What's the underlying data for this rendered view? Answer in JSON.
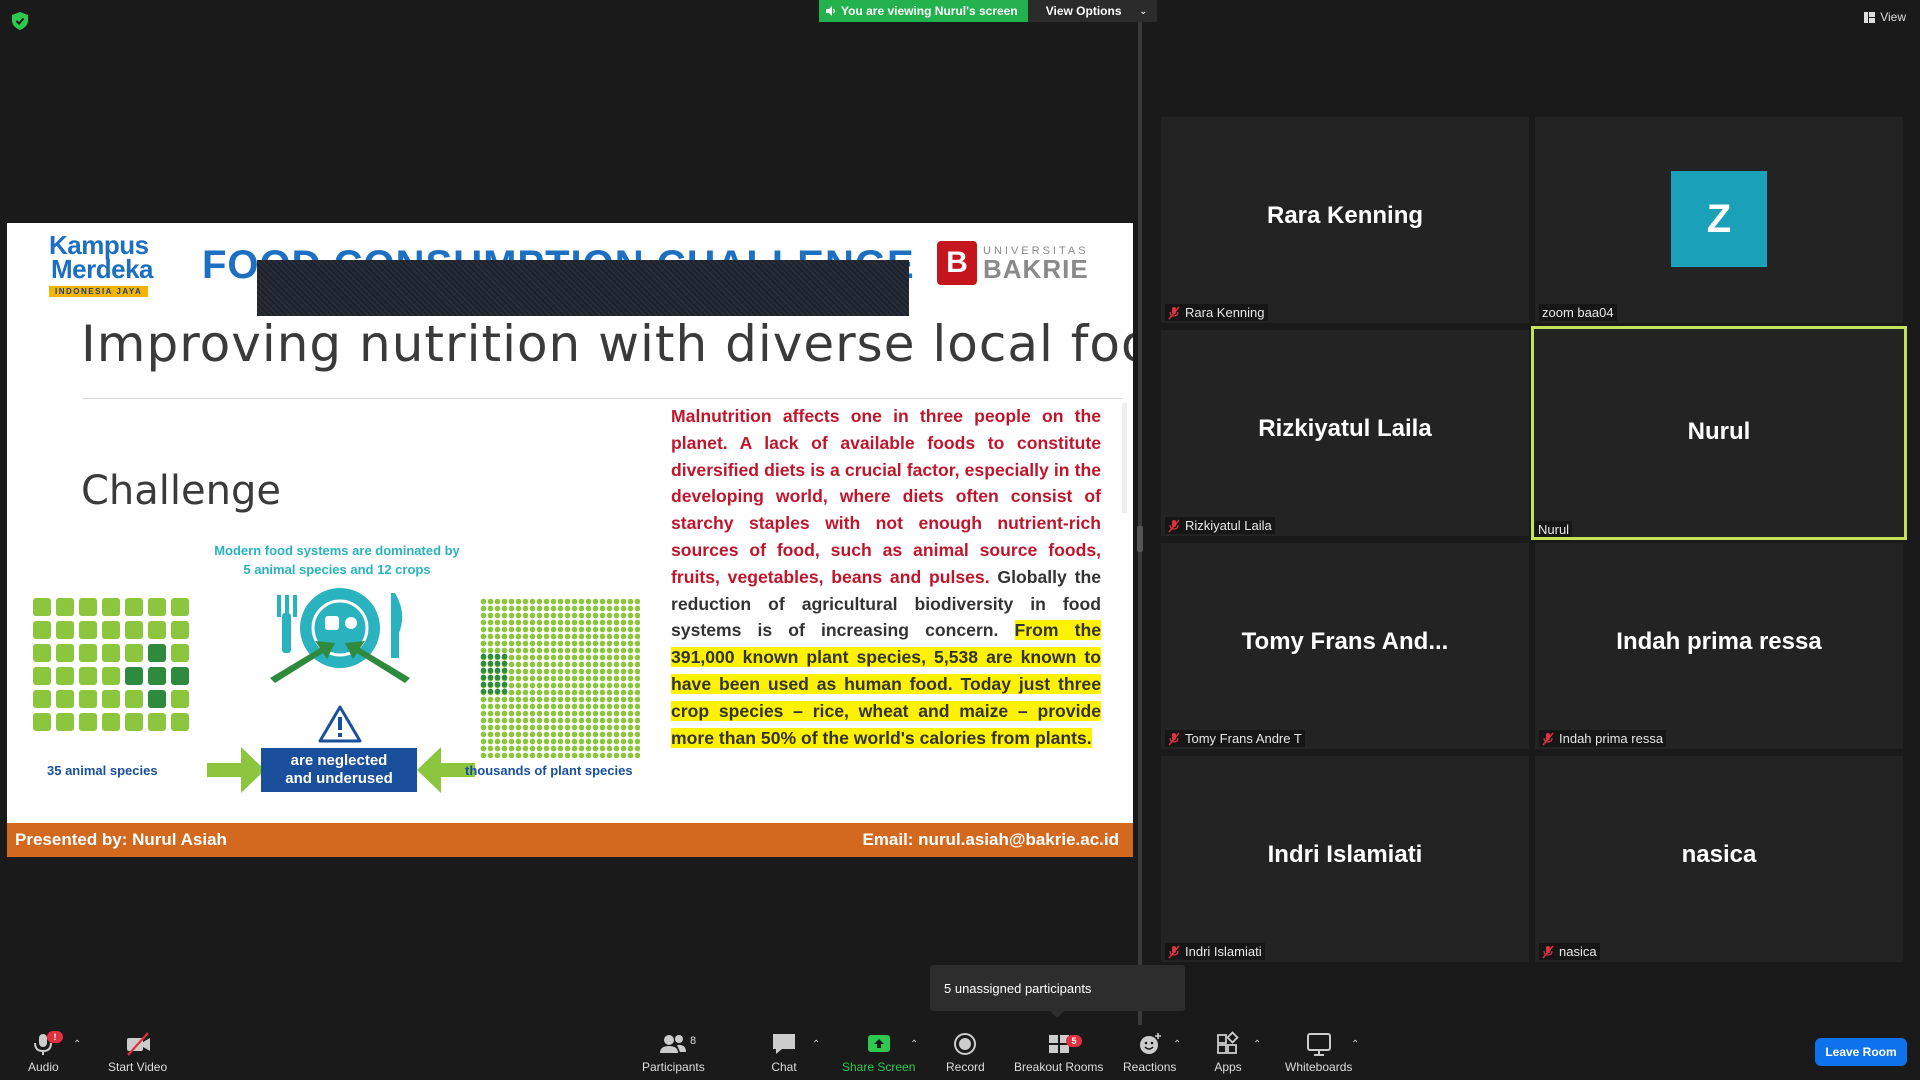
{
  "share_banner": {
    "viewing_text": "You are viewing Nurul's screen",
    "view_options_label": "View Options"
  },
  "view_button": {
    "label": "View"
  },
  "slide": {
    "logo_left": {
      "line1": "Kampus",
      "line2": "Merdeka",
      "tagline": "INDONESIA JAYA"
    },
    "header": "FOOD CONSUMPTION CHALLENGE",
    "logo_right": {
      "mark": "B",
      "line1": "UNIVERSITAS",
      "line2": "BAKRIE"
    },
    "title": "Improving nutrition with diverse local foods",
    "section": "Challenge",
    "infographic": {
      "caption_line1": "Modern food systems are dominated by",
      "caption_line2": "5 animal species and 12 crops",
      "neglected_line1": "are neglected",
      "neglected_line2": "and underused",
      "animal_label": "35 animal species",
      "plant_label": "thousands of plant species"
    },
    "body": {
      "red": "Malnutrition affects one in three people on the planet. A lack of available foods to constitute diversified diets is a crucial factor, especially in the developing world, where diets often consist of starchy staples with not enough nutrient-rich sources of food, such as animal source foods, fruits, vegetables, beans and pulses.",
      "plain": " Globally the reduction of agricultural biodiversity in food systems is of increasing concern. ",
      "highlight": "From the 391,000 known plant species, 5,538 are known to have been used as human food. Today just three crop species – rice, wheat and maize – provide more than 50% of the world's calories from plants."
    },
    "footer": {
      "presenter": "Presented by: Nurul Asiah",
      "email": "Email: nurul.asiah@bakrie.ac.id"
    }
  },
  "gallery": [
    {
      "name": "Rara Kenning",
      "label": "Rara Kenning",
      "muted": true
    },
    {
      "name": "",
      "avatar": "Z",
      "label": "zoom baa04",
      "muted": false
    },
    {
      "name": "Rizkiyatul Laila",
      "label": "Rizkiyatul Laila",
      "muted": true
    },
    {
      "name": "Nurul",
      "label": "Nurul",
      "muted": false,
      "active": true
    },
    {
      "name": "Tomy  Frans  And...",
      "label": "Tomy Frans Andre T",
      "muted": true
    },
    {
      "name": "Indah prima ressa",
      "label": "Indah prima ressa",
      "muted": true
    },
    {
      "name": "Indri Islamiati",
      "label": "Indri Islamiati",
      "muted": true
    },
    {
      "name": "nasica",
      "label": "nasica",
      "muted": true
    }
  ],
  "tooltip": {
    "text": "5 unassigned participants"
  },
  "toolbar": {
    "audio": "Audio",
    "audio_badge": "!",
    "start_video": "Start Video",
    "participants": "Participants",
    "participants_count": "8",
    "chat": "Chat",
    "share_screen": "Share Screen",
    "record": "Record",
    "breakout_rooms": "Breakout Rooms",
    "breakout_badge": "5",
    "reactions": "Reactions",
    "apps": "Apps",
    "whiteboards": "Whiteboards",
    "leave_room": "Leave Room"
  },
  "colors": {
    "banner_green": "#22b14c",
    "active_speaker": "#c5e15a",
    "leave_blue": "#0e72ed",
    "mute_red": "#e0323e",
    "footer_orange": "#d2691e"
  }
}
